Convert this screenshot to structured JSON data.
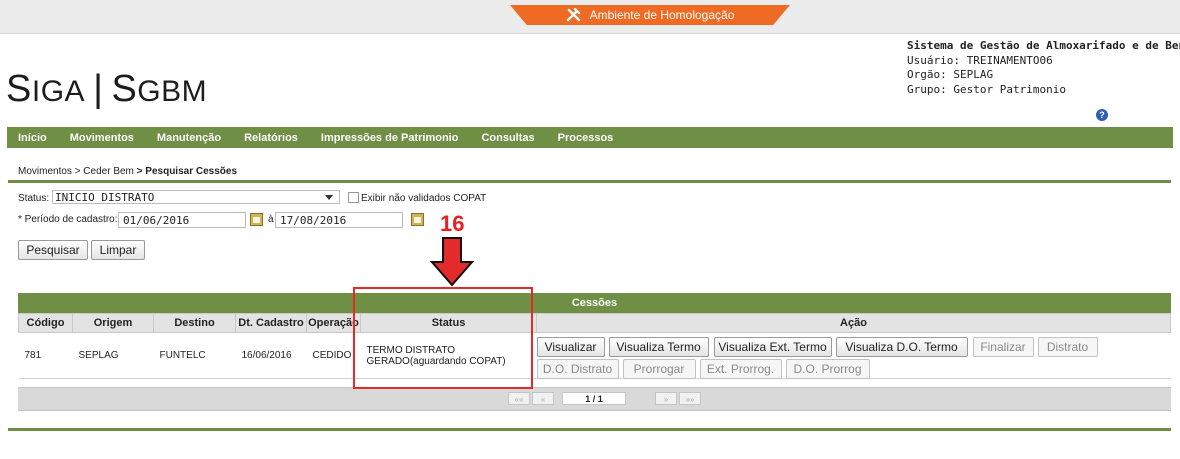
{
  "environment": {
    "label": "Ambiente de Homologação",
    "icon": "tools-icon"
  },
  "logo": {
    "part1_big": "S",
    "part1_small": "I",
    "part1_rest": "GA",
    "separator": "|",
    "part2_big": "S",
    "part2_small": "GBM"
  },
  "system_info": {
    "name": "Sistema de Gestão de Almoxarifado e de Bens",
    "user": "Usuário: TREINAMENTO06",
    "org": "Orgão: SEPLAG",
    "group": "Grupo: Gestor Patrimonio"
  },
  "nav": [
    "Início",
    "Movimentos",
    "Manutenção",
    "Relatórios",
    "Impressões de Patrimonio",
    "Consultas",
    "Processos"
  ],
  "breadcrumb": {
    "item1": "Movimentos",
    "item2": "> Ceder Bem",
    "current": "> Pesquisar Cessões"
  },
  "filters": {
    "status_label": "Status:",
    "status_value": "INICIO DISTRATO",
    "checkbox_label": "Exibir não validados COPAT",
    "period_label": "* Período de cadastro:",
    "date_from": "01/06/2016",
    "date_sep": "à",
    "date_to": "17/08/2016"
  },
  "buttons": {
    "search": "Pesquisar",
    "clear": "Limpar"
  },
  "annotation": {
    "step": "16"
  },
  "table": {
    "title": "Cessões",
    "headers": [
      "Código",
      "Origem",
      "Destino",
      "Dt. Cadastro",
      "Operação",
      "Status",
      "Ação"
    ],
    "row": {
      "codigo": "781",
      "origem": "SEPLAG",
      "destino": "FUNTELC",
      "dt_cadastro": "16/06/2016",
      "operacao": "CEDIDO",
      "status_line1": "TERMO DISTRATO",
      "status_line2": "GERADO(aguardando COPAT)"
    },
    "actions": [
      "Visualizar",
      "Visualiza Termo",
      "Visualiza Ext. Termo",
      "Visualiza D.O. Termo",
      "Finalizar",
      "Distrato",
      "D.O. Distrato",
      "Prorrogar",
      "Ext. Prorrog.",
      "D.O. Prorrog"
    ]
  },
  "pager": {
    "first": "«« ",
    "prev": "«",
    "page": "1 / 1",
    "next": "»",
    "last": "»»"
  }
}
